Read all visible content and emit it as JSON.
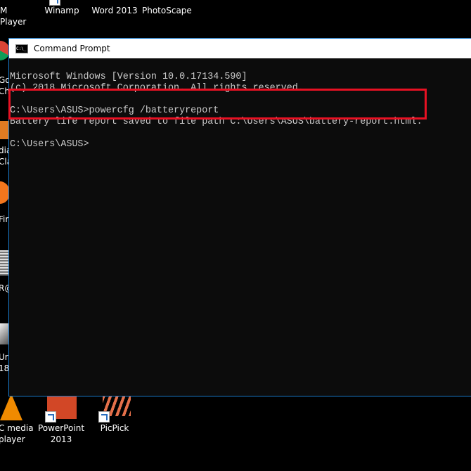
{
  "desktop": {
    "top_icons": [
      "M Player",
      "Winamp",
      "Word 2013",
      "PhotoScape"
    ],
    "left_icons": [
      [
        "Goo",
        "Chr"
      ],
      [
        "dia",
        "Cla"
      ],
      [
        "Fire"
      ],
      [
        "R@"
      ],
      [
        "Ur",
        "18"
      ]
    ],
    "bottom_icons": [
      [
        "C media",
        "player"
      ],
      [
        "PowerPoint",
        "2013"
      ],
      [
        "PicPick"
      ]
    ]
  },
  "window": {
    "title": "Command Prompt",
    "lines": [
      "Microsoft Windows [Version 10.0.17134.590]",
      "(c) 2018 Microsoft Corporation. All rights reserved.",
      "",
      "C:\\Users\\ASUS>powercfg /batteryreport",
      "Battery life report saved to file path C:\\Users\\ASUS\\battery-report.html.",
      "",
      "C:\\Users\\ASUS>"
    ],
    "highlight_color": "#e81123",
    "border_color": "#1979ca"
  }
}
